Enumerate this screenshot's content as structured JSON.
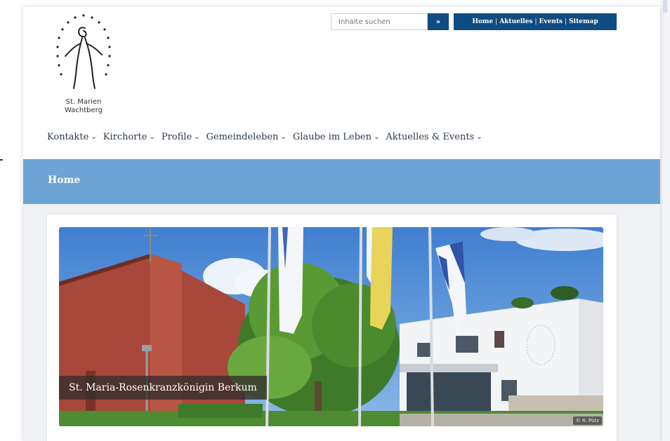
{
  "brand": {
    "line1": "St. Marien",
    "line2": "Wachtberg"
  },
  "search": {
    "placeholder": "Inhalte suchen",
    "button_label": "»"
  },
  "toplinks": [
    "Home",
    "Aktuelles",
    "Events",
    "Sitemap"
  ],
  "toplinks_separator": "|",
  "nav": [
    "Kontakte",
    "Kirchorte",
    "Profile",
    "Gemeindeleben",
    "Glaube im Leben",
    "Aktuelles & Events"
  ],
  "nav_chevron": "⌄",
  "page_title": "Home",
  "slide": {
    "caption": "St. Maria-Rosenkranzkönigin Berkum",
    "credit": "© R. Pütz"
  },
  "colors": {
    "accent": "#0f4c81",
    "banner": "#6ea3d6",
    "content_bg": "#eff1f4"
  },
  "icons": {
    "logo": "madonna-stars-logo",
    "nav": "chevron-down-icon"
  }
}
